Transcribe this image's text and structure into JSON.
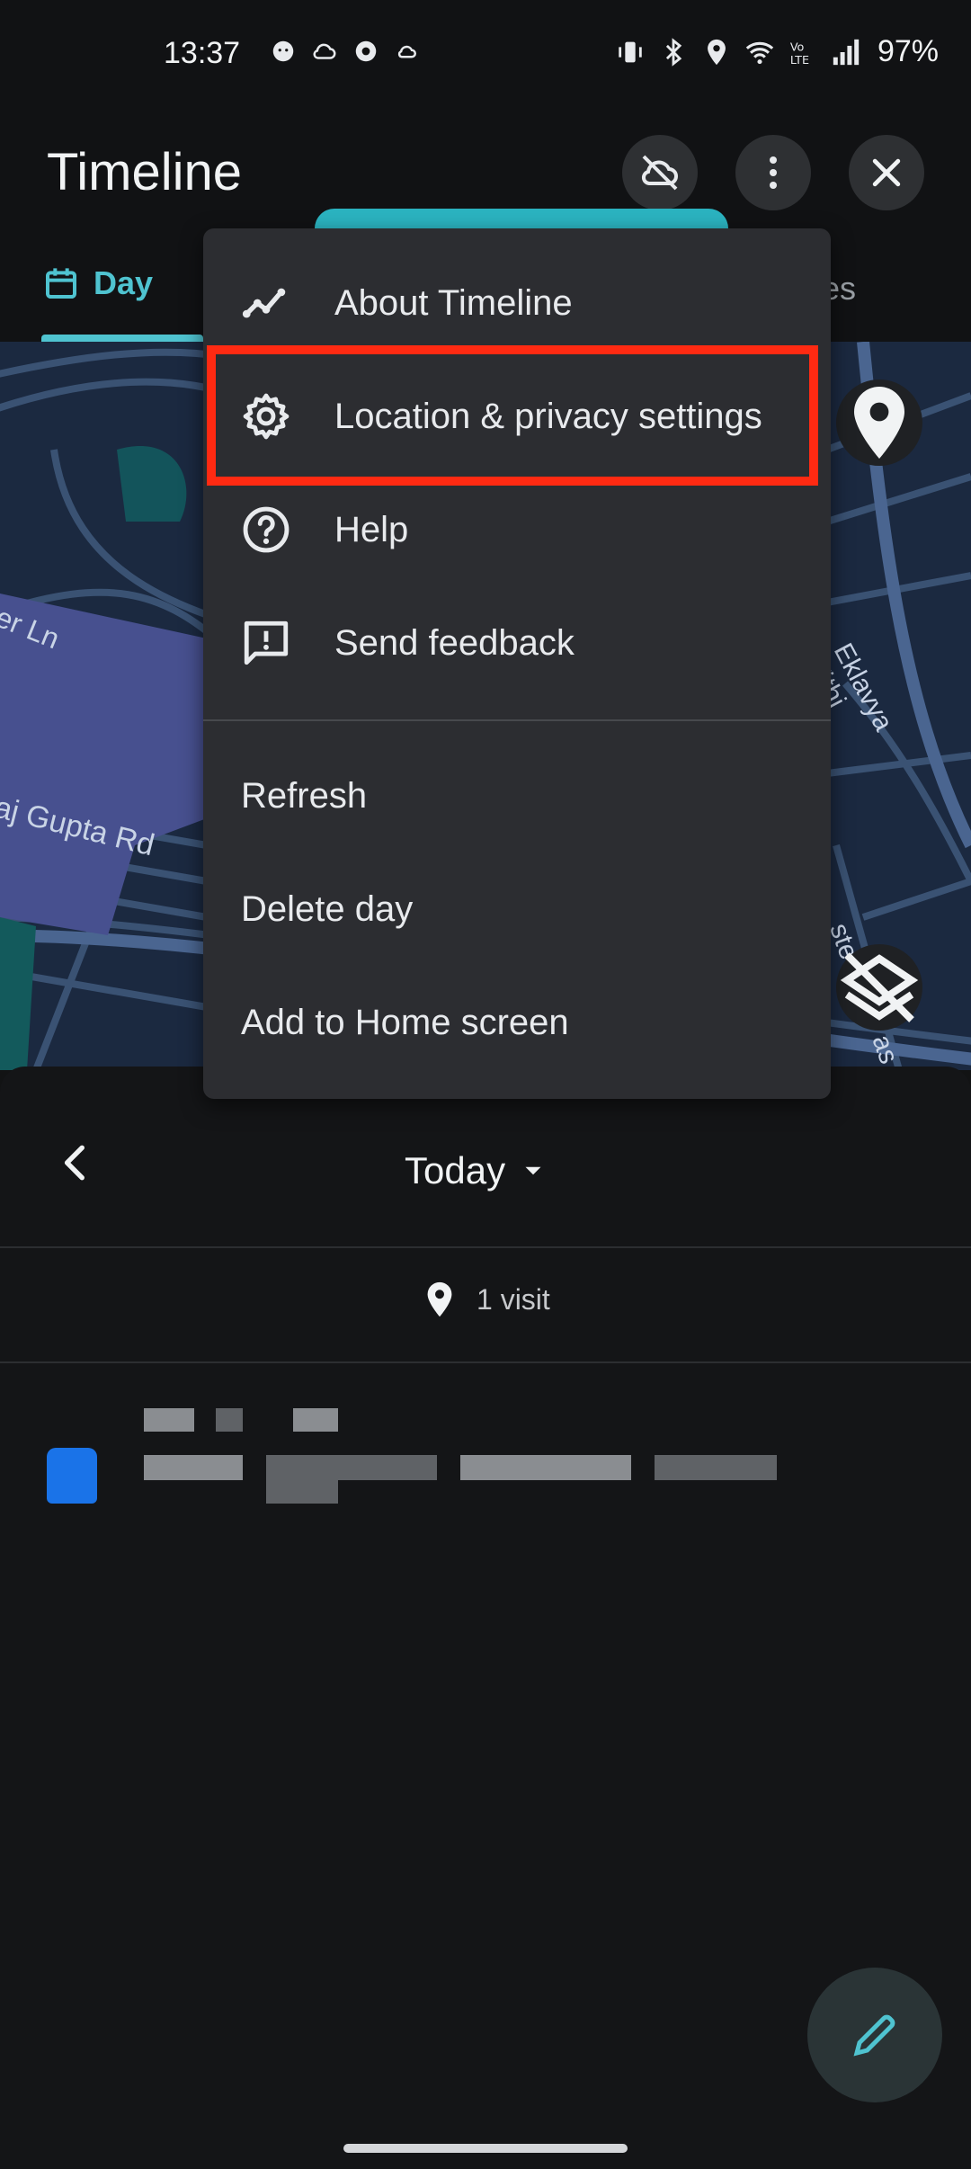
{
  "status_bar": {
    "time": "13:37",
    "battery": "97%",
    "left_icons": [
      "face-icon",
      "cloud-icon",
      "chrome-icon",
      "small-cloud-icon"
    ],
    "right_icons": [
      "vibrate-icon",
      "bluetooth-icon",
      "location-icon",
      "wifi-icon",
      "volte-icon",
      "signal-icon"
    ]
  },
  "app_bar": {
    "title": "Timeline",
    "icons": [
      "cloud-off-icon",
      "more-vert-icon",
      "close-icon"
    ]
  },
  "tabs": {
    "day_label": "Day",
    "activities_partial": "ities"
  },
  "map": {
    "labels": [
      "er Ln",
      "Eklavya Vithi",
      "aj Gupta Rd",
      "ste",
      "as"
    ]
  },
  "menu": {
    "items": [
      {
        "label": "About Timeline",
        "icon": "timeline-icon"
      },
      {
        "label": "Location & privacy settings",
        "icon": "gear-icon"
      },
      {
        "label": "Help",
        "icon": "help-icon"
      },
      {
        "label": "Send feedback",
        "icon": "feedback-icon"
      },
      {
        "label": "Refresh"
      },
      {
        "label": "Delete day"
      },
      {
        "label": "Add to Home screen"
      }
    ],
    "highlight_color": "#ff2a12"
  },
  "sheet": {
    "date_label": "Today",
    "visits": "1 visit"
  },
  "colors": {
    "accent": "#4fc3d0",
    "visit_icon": "#1a73e8",
    "background": "#121314",
    "menu_bg": "#2c2d31"
  }
}
